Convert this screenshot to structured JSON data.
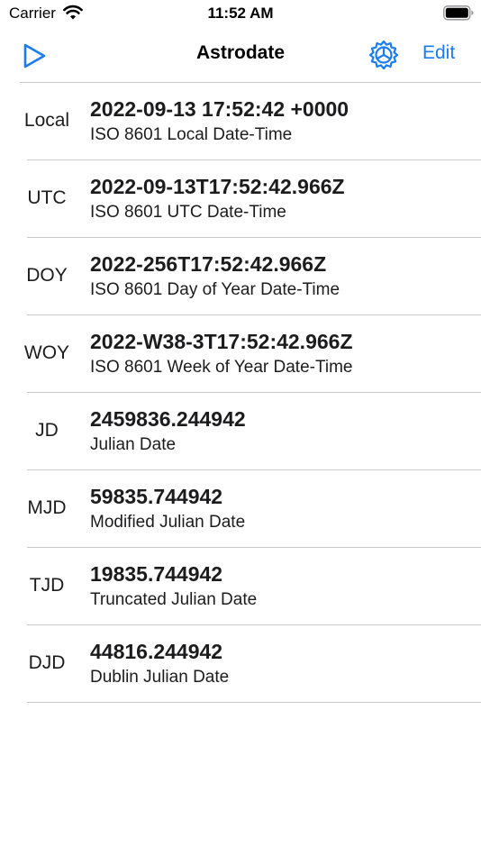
{
  "status_bar": {
    "carrier": "Carrier",
    "time": "11:52 AM",
    "icons": [
      "wifi-icon",
      "battery-icon"
    ]
  },
  "nav": {
    "title": "Astrodate",
    "edit_label": "Edit",
    "accent_color": "#1a7cf5",
    "icons": [
      "play-icon",
      "gear-icon"
    ]
  },
  "rows": [
    {
      "key": "Local",
      "value": "2022-09-13 17:52:42 +0000",
      "desc": "ISO 8601 Local Date-Time"
    },
    {
      "key": "UTC",
      "value": "2022-09-13T17:52:42.966Z",
      "desc": "ISO 8601 UTC Date-Time"
    },
    {
      "key": "DOY",
      "value": "2022-256T17:52:42.966Z",
      "desc": "ISO 8601 Day of Year Date-Time"
    },
    {
      "key": "WOY",
      "value": "2022-W38-3T17:52:42.966Z",
      "desc": "ISO 8601 Week of Year Date-Time"
    },
    {
      "key": "JD",
      "value": "2459836.244942",
      "desc": "Julian Date"
    },
    {
      "key": "MJD",
      "value": "59835.744942",
      "desc": "Modified Julian Date"
    },
    {
      "key": "TJD",
      "value": "19835.744942",
      "desc": "Truncated Julian Date"
    },
    {
      "key": "DJD",
      "value": "44816.244942",
      "desc": "Dublin Julian Date"
    }
  ]
}
